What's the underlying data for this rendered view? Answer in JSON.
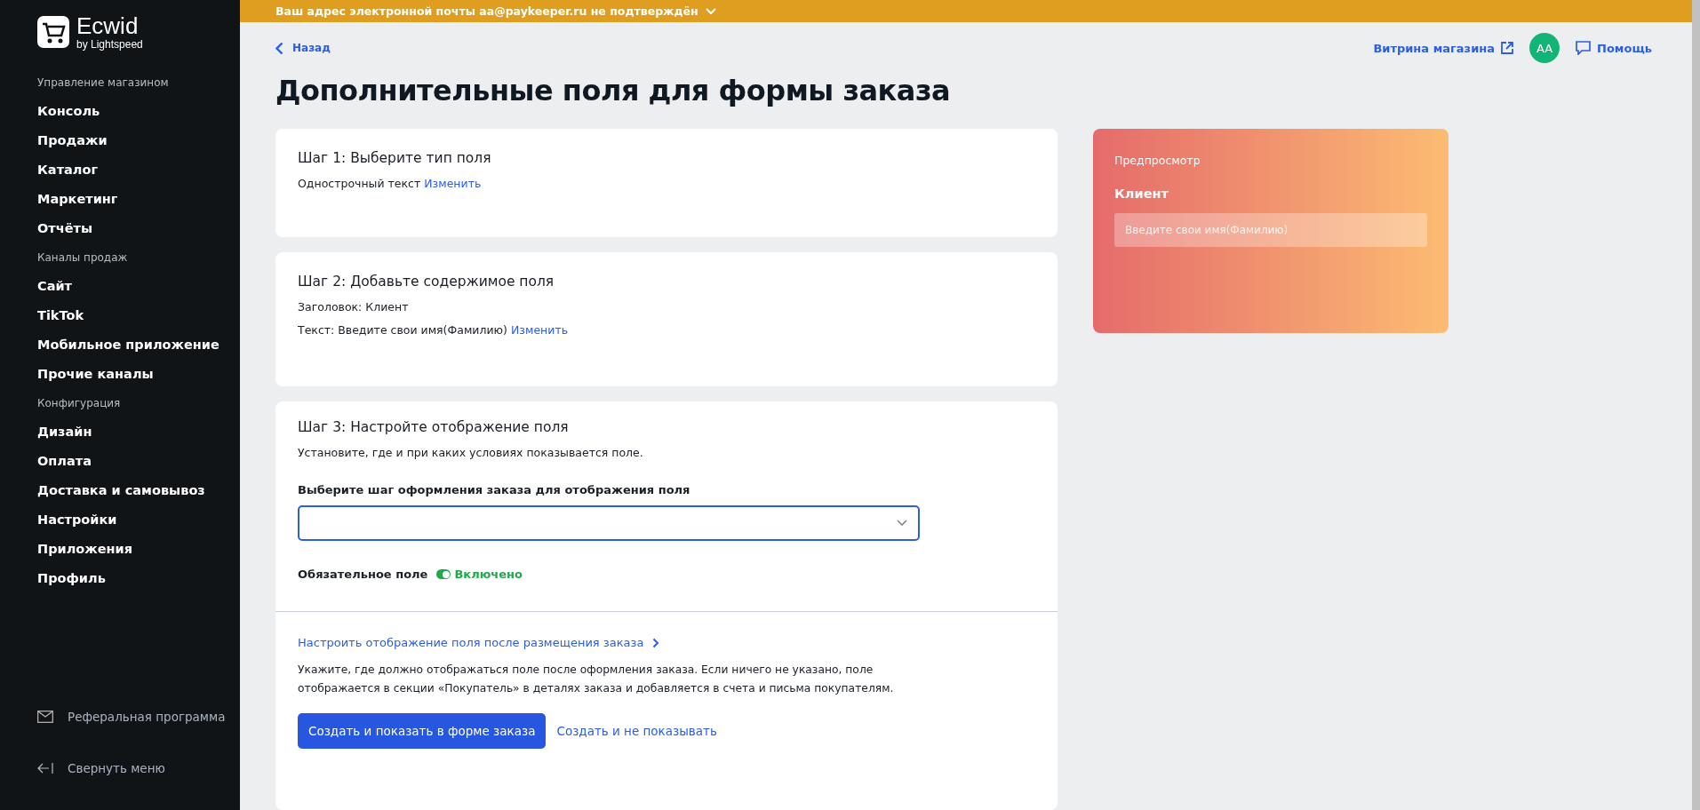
{
  "sidebar": {
    "logo": {
      "name": "Ecwid",
      "tagline": "by Lightspeed"
    },
    "sections": [
      {
        "title": "Управление магазином",
        "items": [
          {
            "label": "Консоль"
          },
          {
            "label": "Продажи"
          },
          {
            "label": "Каталог"
          },
          {
            "label": "Маркетинг"
          },
          {
            "label": "Отчёты"
          }
        ]
      },
      {
        "title": "Каналы продаж",
        "items": [
          {
            "label": "Сайт"
          },
          {
            "label": "TikTok"
          },
          {
            "label": "Мобильное приложение"
          },
          {
            "label": "Прочие каналы"
          }
        ]
      },
      {
        "title": "Конфигурация",
        "items": [
          {
            "label": "Дизайн"
          },
          {
            "label": "Оплата"
          },
          {
            "label": "Доставка и самовывоз"
          },
          {
            "label": "Настройки"
          },
          {
            "label": "Приложения"
          },
          {
            "label": "Профиль"
          }
        ]
      }
    ],
    "footer": [
      {
        "kind": "mail",
        "label": "Реферальная программа"
      },
      {
        "kind": "collapse",
        "label": "Свернуть меню"
      }
    ]
  },
  "banner": {
    "text": "Ваш адрес электронной почты aa@paykeeper.ru не подтверждён"
  },
  "header": {
    "back": "Назад",
    "storefront": "Витрина магазина",
    "avatar": "AA",
    "help": "Помощь"
  },
  "title": "Дополнительные поля для формы заказа",
  "step1": {
    "title": "Шаг 1: Выберите тип поля",
    "value": "Однострочный текст",
    "link": "Изменить"
  },
  "step2": {
    "title": "Шаг 2: Добавьте содержимое поля",
    "heading": "Заголовок: Клиент",
    "text": "Текст: Введите свои имя(Фамилию)",
    "link": "Изменить"
  },
  "step3": {
    "title": "Шаг 3: Настройте отображение поля",
    "description": "Установите, где и при каких условиях показывается поле.",
    "select_label": "Выберите шаг оформления заказа для отображения поля",
    "required_label": "Обязательное поле",
    "required": {
      "on": true,
      "label": "Включено"
    },
    "after_link": "Настроить отображение поля после размещения заказа",
    "after_text": "Укажите, где должно отображаться поле после оформления заказа. Если ничего не указано, поле отображается в секции «Покупатель» в деталях заказа и добавляется в счета и письма покупателям.",
    "primary_button": "Создать и показать в форме заказа",
    "secondary_button": "Создать и не показывать"
  },
  "preview": {
    "title": "Предпросмотр",
    "field_label": "Клиент",
    "placeholder": "Введите свои имя(Фамилию)"
  }
}
